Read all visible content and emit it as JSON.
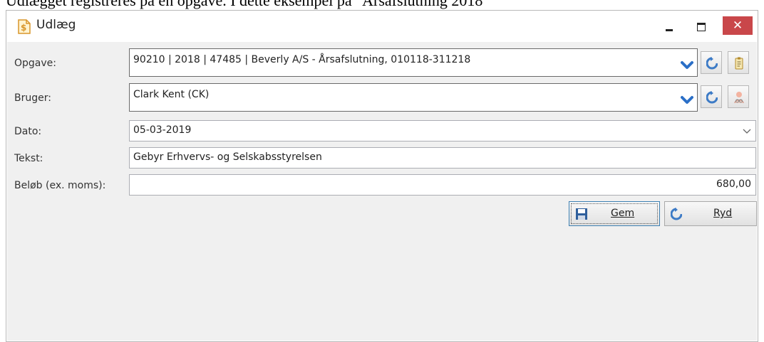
{
  "caption": "Udlægget registreres på en opgave. I dette eksempel på \"Årsafslutning 2018\"",
  "window": {
    "title": "Udlæg",
    "close_label": "✕"
  },
  "form": {
    "opgave": {
      "label": "Opgave:",
      "value": "90210 | 2018 | 47485 | Beverly A/S  -  Årsafslutning, 010118-311218"
    },
    "bruger": {
      "label": "Bruger:",
      "value": "Clark Kent (CK)"
    },
    "dato": {
      "label": "Dato:",
      "value": "05-03-2019"
    },
    "tekst": {
      "label": "Tekst:",
      "value": "Gebyr Erhvervs- og Selskabsstyrelsen"
    },
    "beloeb": {
      "label": "Beløb (ex. moms):",
      "value": "680,00"
    }
  },
  "buttons": {
    "save_label": "Gem",
    "clear_label": "Ryd"
  },
  "colors": {
    "accent": "#2b6fc7",
    "close": "#c9474a",
    "refresh": "#3d7bc6"
  },
  "icons": [
    "money-document-icon",
    "chevron-down-icon",
    "refresh-icon",
    "task-icon",
    "user-icon",
    "save-icon"
  ]
}
